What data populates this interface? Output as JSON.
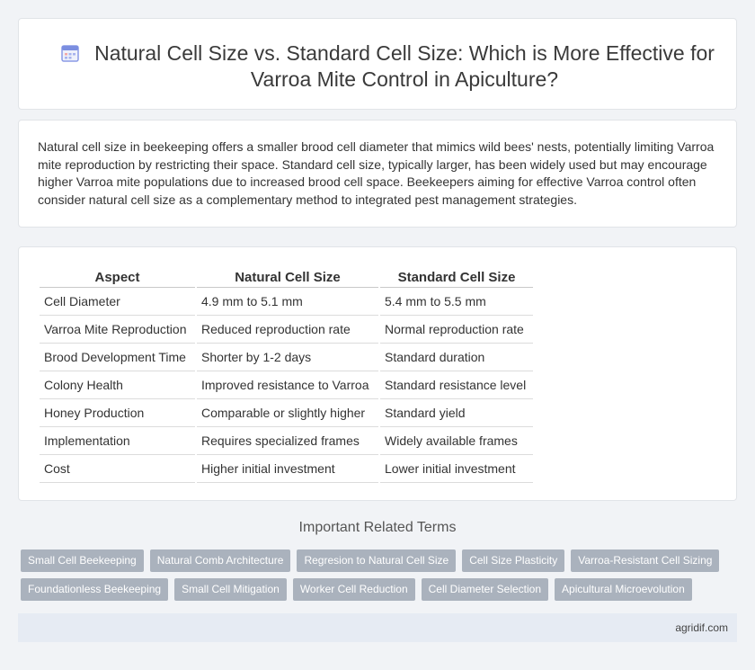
{
  "header": {
    "title": "Natural Cell Size vs. Standard Cell Size: Which is More Effective for Varroa Mite Control in Apiculture?",
    "icon": "calendar-icon"
  },
  "intro": {
    "text": "Natural cell size in beekeeping offers a smaller brood cell diameter that mimics wild bees' nests, potentially limiting Varroa mite reproduction by restricting their space. Standard cell size, typically larger, has been widely used but may encourage higher Varroa mite populations due to increased brood cell space. Beekeepers aiming for effective Varroa control often consider natural cell size as a complementary method to integrated pest management strategies."
  },
  "table": {
    "headers": [
      "Aspect",
      "Natural Cell Size",
      "Standard Cell Size"
    ],
    "rows": [
      [
        "Cell Diameter",
        "4.9 mm to 5.1 mm",
        "5.4 mm to 5.5 mm"
      ],
      [
        "Varroa Mite Reproduction",
        "Reduced reproduction rate",
        "Normal reproduction rate"
      ],
      [
        "Brood Development Time",
        "Shorter by 1-2 days",
        "Standard duration"
      ],
      [
        "Colony Health",
        "Improved resistance to Varroa",
        "Standard resistance level"
      ],
      [
        "Honey Production",
        "Comparable or slightly higher",
        "Standard yield"
      ],
      [
        "Implementation",
        "Requires specialized frames",
        "Widely available frames"
      ],
      [
        "Cost",
        "Higher initial investment",
        "Lower initial investment"
      ]
    ]
  },
  "related": {
    "heading": "Important Related Terms",
    "row1": [
      "Small Cell Beekeeping",
      "Natural Comb Architecture",
      "Regresion to Natural Cell Size",
      "Cell Size Plasticity",
      "Varroa-Resistant Cell Sizing"
    ],
    "row2": [
      "Foundationless Beekeeping",
      "Small Cell Mitigation",
      "Worker Cell Reduction",
      "Cell Diameter Selection",
      "Apicultural Microevolution"
    ]
  },
  "footer": {
    "site": "agridif.com"
  },
  "colors": {
    "tag_background": "#aab2bd",
    "icon_accent": "#7b8ee0",
    "footer_background": "#e6ebf3"
  }
}
